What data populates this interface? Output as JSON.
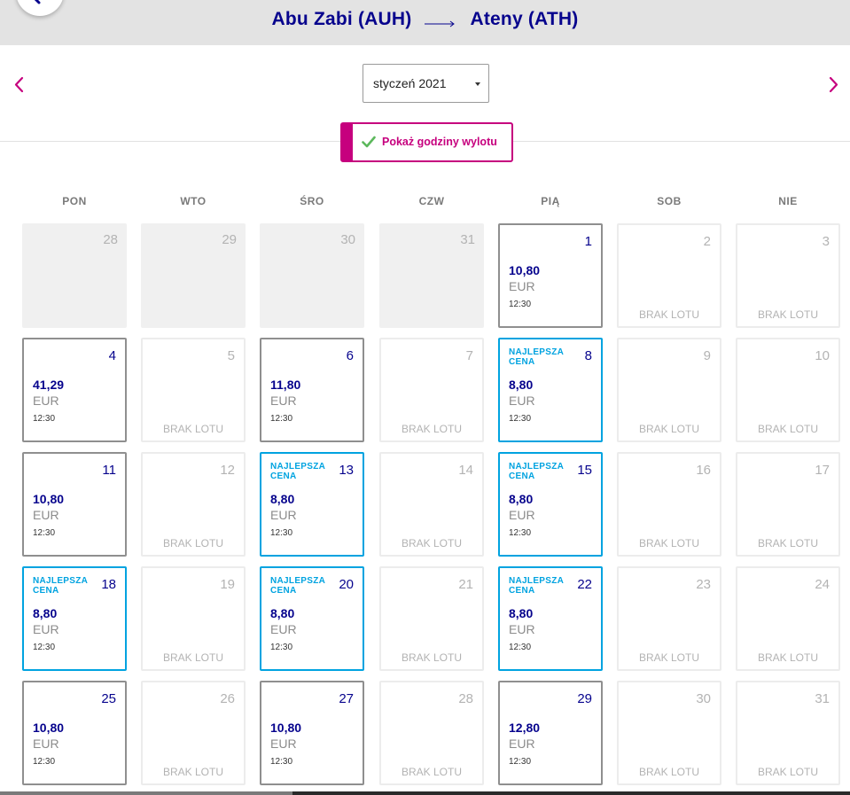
{
  "header": {
    "origin": "Abu Zabi (AUH)",
    "destination": "Ateny (ATH)",
    "arrow_icon": "long-arrow-right-icon",
    "search_icon": "search-icon"
  },
  "month_nav": {
    "selected_month": "styczeń 2021",
    "prev_icon": "chevron-left-icon",
    "next_icon": "chevron-right-icon"
  },
  "toggle": {
    "label": "Pokaż godziny wylotu",
    "icon": "check-icon"
  },
  "colors": {
    "brand_magenta": "#c6007e",
    "brand_navy": "#06038d",
    "best_price_blue": "#00a3e0",
    "check_green": "#5cb85c"
  },
  "weekdays": [
    "PON",
    "WTO",
    "ŚRO",
    "CZW",
    "PIĄ",
    "SOB",
    "NIE"
  ],
  "best_label": "NAJLEPSZA CENA",
  "no_flight_label": "BRAK LOTU",
  "calendar": [
    {
      "day": "28",
      "state": "empty"
    },
    {
      "day": "29",
      "state": "empty"
    },
    {
      "day": "30",
      "state": "empty"
    },
    {
      "day": "31",
      "state": "empty"
    },
    {
      "day": "1",
      "state": "flight",
      "price": "10,80",
      "currency": "EUR",
      "time": "12:30"
    },
    {
      "day": "2",
      "state": "none"
    },
    {
      "day": "3",
      "state": "none"
    },
    {
      "day": "4",
      "state": "flight",
      "price": "41,29",
      "currency": "EUR",
      "time": "12:30"
    },
    {
      "day": "5",
      "state": "none"
    },
    {
      "day": "6",
      "state": "flight",
      "price": "11,80",
      "currency": "EUR",
      "time": "12:30"
    },
    {
      "day": "7",
      "state": "none"
    },
    {
      "day": "8",
      "state": "best",
      "price": "8,80",
      "currency": "EUR",
      "time": "12:30"
    },
    {
      "day": "9",
      "state": "none"
    },
    {
      "day": "10",
      "state": "none"
    },
    {
      "day": "11",
      "state": "flight",
      "price": "10,80",
      "currency": "EUR",
      "time": "12:30"
    },
    {
      "day": "12",
      "state": "none"
    },
    {
      "day": "13",
      "state": "best",
      "price": "8,80",
      "currency": "EUR",
      "time": "12:30"
    },
    {
      "day": "14",
      "state": "none"
    },
    {
      "day": "15",
      "state": "best",
      "price": "8,80",
      "currency": "EUR",
      "time": "12:30"
    },
    {
      "day": "16",
      "state": "none"
    },
    {
      "day": "17",
      "state": "none"
    },
    {
      "day": "18",
      "state": "best",
      "price": "8,80",
      "currency": "EUR",
      "time": "12:30"
    },
    {
      "day": "19",
      "state": "none"
    },
    {
      "day": "20",
      "state": "best",
      "price": "8,80",
      "currency": "EUR",
      "time": "12:30"
    },
    {
      "day": "21",
      "state": "none"
    },
    {
      "day": "22",
      "state": "best",
      "price": "8,80",
      "currency": "EUR",
      "time": "12:30"
    },
    {
      "day": "23",
      "state": "none"
    },
    {
      "day": "24",
      "state": "none"
    },
    {
      "day": "25",
      "state": "flight",
      "price": "10,80",
      "currency": "EUR",
      "time": "12:30"
    },
    {
      "day": "26",
      "state": "none"
    },
    {
      "day": "27",
      "state": "flight",
      "price": "10,80",
      "currency": "EUR",
      "time": "12:30"
    },
    {
      "day": "28",
      "state": "none"
    },
    {
      "day": "29",
      "state": "flight",
      "price": "12,80",
      "currency": "EUR",
      "time": "12:30"
    },
    {
      "day": "30",
      "state": "none"
    },
    {
      "day": "31",
      "state": "none"
    }
  ]
}
